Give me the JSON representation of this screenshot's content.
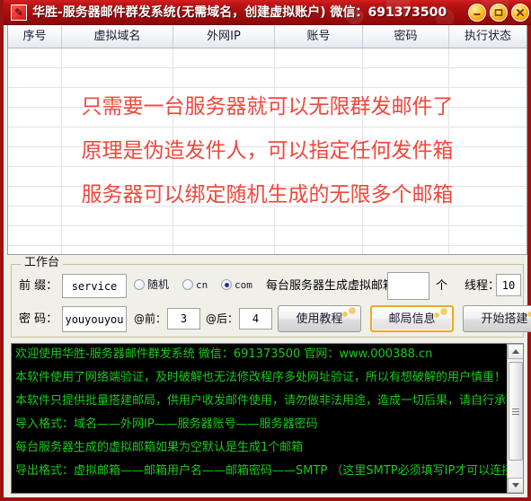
{
  "window": {
    "title": "华胜-服务器邮件群发系统(无需域名，创建虚拟账户) 微信：691373500",
    "app_icon": "app-logo-icon",
    "controls": {
      "minimize": "minimize-button",
      "maximize": "maximize-button",
      "close": "close-button"
    }
  },
  "grid": {
    "columns": [
      "序号",
      "虚拟域名",
      "外网IP",
      "账号",
      "密码",
      "执行状态"
    ],
    "rows": [],
    "promo_lines": [
      "只需要一台服务器就可以无限群发邮件了",
      "原理是伪造发件人，可以指定任何发件箱",
      "服务器可以绑定随机生成的无限多个邮箱"
    ],
    "promo_color": "#f0473c"
  },
  "workbench": {
    "legend": "工作台",
    "prefix_label": "前 缀：",
    "prefix_value": "service",
    "suffix_options": [
      {
        "label": "随机",
        "selected": false
      },
      {
        "label": "cn",
        "selected": false
      },
      {
        "label": "com",
        "selected": true
      }
    ],
    "mailbox_label": "每台服务器生成虚拟邮箱：",
    "mailbox_value": "",
    "mailbox_unit": "个",
    "thread_label": "线程：",
    "thread_value": "10",
    "password_label": "密 码：",
    "password_value": "youyouyou",
    "at_before_label": "@前：",
    "at_before_value": "3",
    "at_after_label": "@后：",
    "at_after_value": "4",
    "buttons": [
      {
        "label": "使用教程",
        "highlighted": false
      },
      {
        "label": "邮局信息",
        "highlighted": true
      },
      {
        "label": "开始搭建",
        "highlighted": false
      }
    ]
  },
  "console": {
    "text_color": "#1aca1a",
    "background": "#000000",
    "lines": [
      "欢迎使用华胜-服务器邮件群发系统 微信：691373500 官网：www.000388.cn",
      "本软件使用了网络端验证，及时破解也无法修改程序多处网址验证，所以有想破解的用户慎重！",
      "本软件只提供批量搭建邮局，供用户收发邮件使用，请勿做非法用途，造成一切后果，请自行承担！",
      "导入格式：域名——外网IP——服务器账号——服务器密码",
      "每台服务器生成的虚拟邮箱如果为空默认是生成1个邮箱",
      "导出格式：虚拟邮箱——邮箱用户名——邮箱密码——SMTP （这里SMTP必须填写IP才可以连接）"
    ],
    "scrollbar": {
      "up": "▲",
      "down": "▼"
    }
  }
}
